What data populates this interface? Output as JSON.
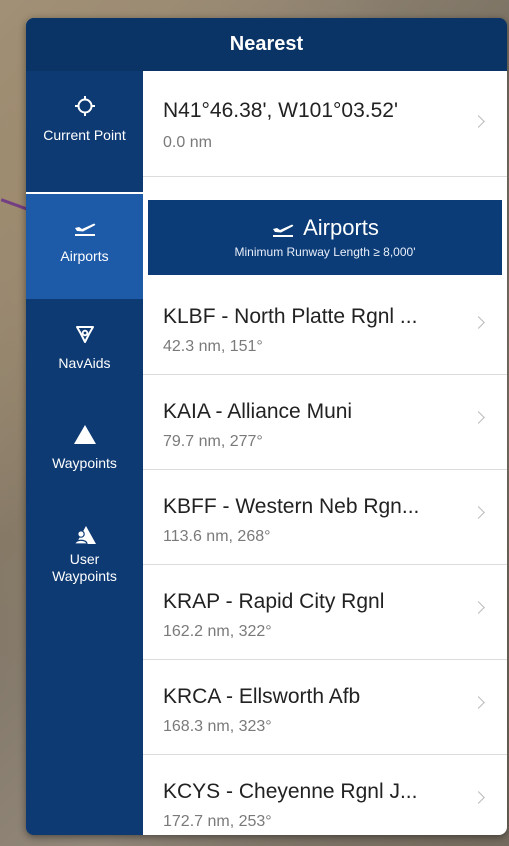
{
  "header": {
    "title": "Nearest"
  },
  "sidebar": {
    "items": [
      {
        "label": "Current Point",
        "icon": "crosshair-icon",
        "active": false
      },
      {
        "label": "Airports",
        "icon": "airplane-takeoff-icon",
        "active": true
      },
      {
        "label": "NavAids",
        "icon": "navaid-icon",
        "active": false
      },
      {
        "label": "Waypoints",
        "icon": "triangle-icon",
        "active": false
      },
      {
        "label": "User\nWaypoints",
        "icon": "user-waypoint-icon",
        "active": false
      }
    ]
  },
  "current_point": {
    "coords": "N41°46.38', W101°03.52'",
    "distance": "0.0 nm"
  },
  "banner": {
    "title": "Airports",
    "subtitle": "Minimum Runway Length ≥ 8,000'"
  },
  "airports": [
    {
      "name": "KLBF - North Platte Rgnl ...",
      "detail": "42.3 nm, 151°"
    },
    {
      "name": "KAIA - Alliance Muni",
      "detail": "79.7 nm, 277°"
    },
    {
      "name": "KBFF - Western Neb Rgn...",
      "detail": "113.6 nm, 268°"
    },
    {
      "name": "KRAP - Rapid City Rgnl",
      "detail": "162.2 nm, 322°"
    },
    {
      "name": "KRCA - Ellsworth Afb",
      "detail": "168.3 nm, 323°"
    },
    {
      "name": "KCYS - Cheyenne Rgnl J...",
      "detail": "172.7 nm, 253°"
    }
  ],
  "colors": {
    "accent": "#0d3a73",
    "active": "#1d5aa8",
    "banner": "#0b3c78"
  }
}
